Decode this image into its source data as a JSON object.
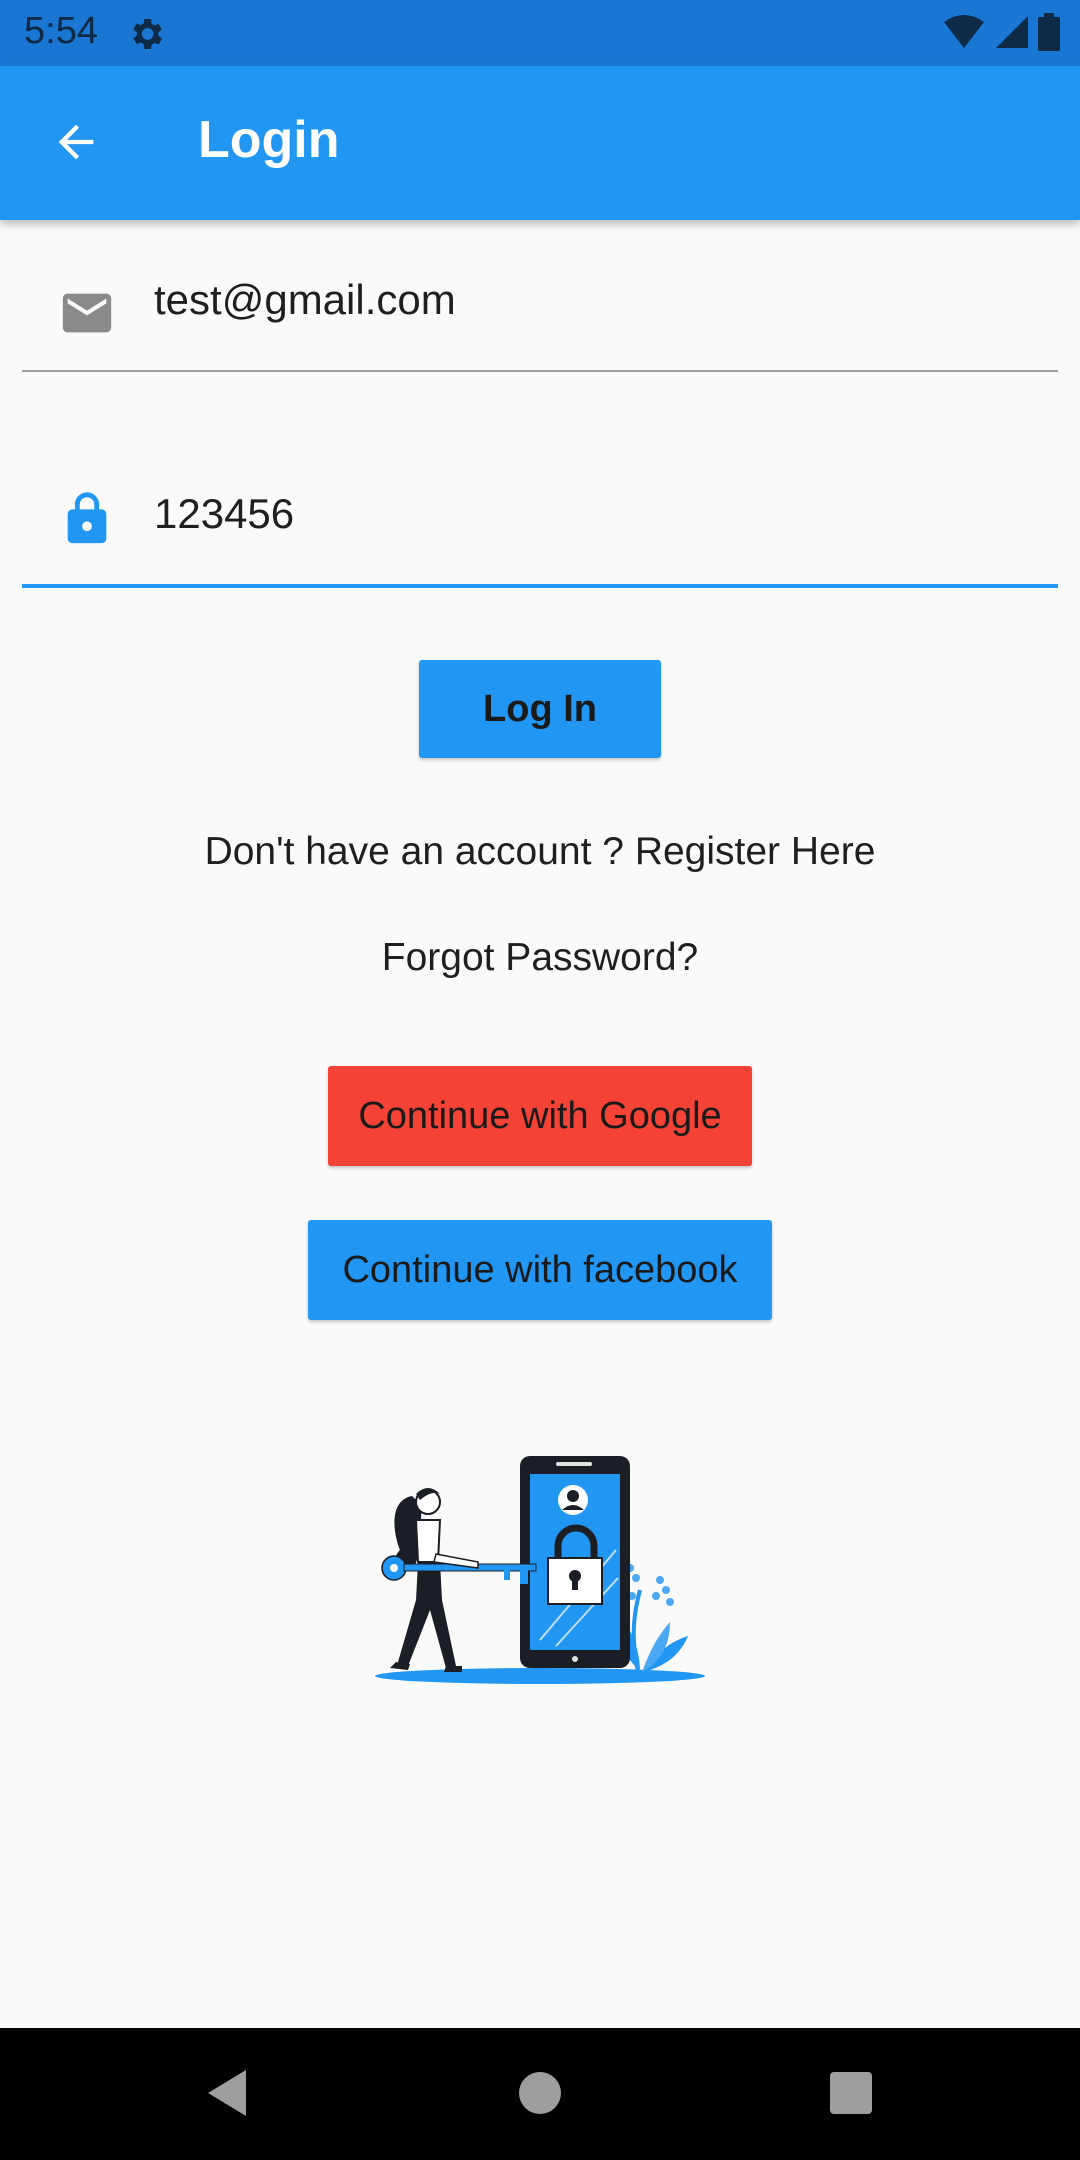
{
  "status_bar": {
    "time": "5:54",
    "icons": [
      "gear-icon",
      "wifi-icon",
      "cell-signal-icon",
      "battery-icon"
    ]
  },
  "app_bar": {
    "title": "Login",
    "back_icon": "arrow-back-icon",
    "color": "#2196f3"
  },
  "form": {
    "email": {
      "icon": "mail-icon",
      "value": "test@gmail.com"
    },
    "password": {
      "icon": "lock-icon",
      "value": "123456"
    }
  },
  "actions": {
    "login_label": "Log In",
    "register_text": "Don't have an account ? Register Here",
    "forgot_text": "Forgot Password?",
    "google_label": "Continue with Google",
    "facebook_label": "Continue with facebook"
  },
  "colors": {
    "primary": "#2196f3",
    "google": "#f44336",
    "background": "#fafafa"
  },
  "nav_bar": {
    "icons": [
      "back-triangle-icon",
      "home-circle-icon",
      "recents-square-icon"
    ]
  }
}
